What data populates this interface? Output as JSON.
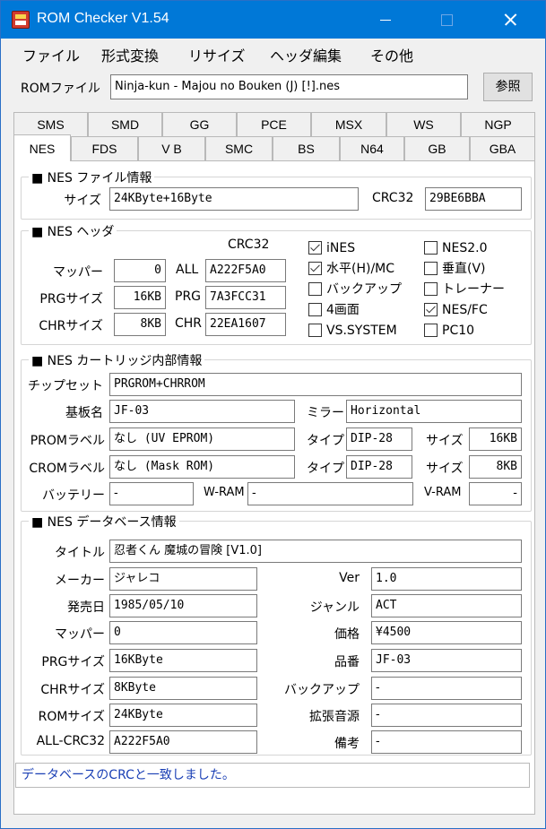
{
  "window": {
    "title": "ROM Checker V1.54"
  },
  "menu": [
    "ファイル",
    "形式変換",
    "リサイズ",
    "ヘッダ編集",
    "その他"
  ],
  "rom_file": {
    "label": "ROMファイル",
    "value": "Ninja-kun - Majou no Bouken (J) [!].nes",
    "browse_label": "参照"
  },
  "tabs_row1": [
    "SMS",
    "SMD",
    "GG",
    "PCE",
    "MSX",
    "WS",
    "NGP"
  ],
  "tabs_row2": [
    "NES",
    "FDS",
    "V B",
    "SMC",
    "BS",
    "N64",
    "GB",
    "GBA"
  ],
  "active_tab": "NES",
  "file_info": {
    "title": "■ NES ファイル情報",
    "size_label": "サイズ",
    "size_value": "24KByte+16Byte",
    "crc_label": "CRC32",
    "crc_value": "29BE6BBA"
  },
  "header": {
    "title": "■ NES ヘッダ",
    "crc_col_label": "CRC32",
    "mapper_label": "マッパー",
    "mapper_value": "0",
    "all_label": "ALL",
    "all_crc": "A222F5A0",
    "prg_size_label": "PRGサイズ",
    "prg_size_value": "16KB",
    "prg_label": "PRG",
    "prg_crc": "7A3FCC31",
    "chr_size_label": "CHRサイズ",
    "chr_size_value": "8KB",
    "chr_label": "CHR",
    "chr_crc": "22EA1607",
    "checks": [
      {
        "label": "iNES",
        "checked": true
      },
      {
        "label": "NES2.0",
        "checked": false
      },
      {
        "label": "水平(H)/MC",
        "checked": true
      },
      {
        "label": "垂直(V)",
        "checked": false
      },
      {
        "label": "バックアップ",
        "checked": false
      },
      {
        "label": "トレーナー",
        "checked": false
      },
      {
        "label": "4画面",
        "checked": false
      },
      {
        "label": "NES/FC",
        "checked": true
      },
      {
        "label": "VS.SYSTEM",
        "checked": false
      },
      {
        "label": "PC10",
        "checked": false
      }
    ]
  },
  "cart": {
    "title": "■ NES カートリッジ内部情報",
    "chipset_label": "チップセット",
    "chipset_value": "PRGROM+CHRROM",
    "board_label": "基板名",
    "board_value": "JF-03",
    "mirror_label": "ミラー",
    "mirror_value": "Horizontal",
    "prom_label": "PROMラベル",
    "prom_value": "なし (UV EPROM)",
    "prom_type_label": "タイプ",
    "prom_type_value": "DIP-28",
    "prom_size_label": "サイズ",
    "prom_size_value": "16KB",
    "crom_label": "CROMラベル",
    "crom_value": "なし (Mask ROM)",
    "crom_type_label": "タイプ",
    "crom_type_value": "DIP-28",
    "crom_size_label": "サイズ",
    "crom_size_value": "8KB",
    "battery_label": "バッテリー",
    "battery_value": "-",
    "wram_label": "W-RAM",
    "wram_value": "-",
    "vram_label": "V-RAM",
    "vram_value": "-"
  },
  "db": {
    "title": "■ NES データベース情報",
    "title_label": "タイトル",
    "title_value": "忍者くん 魔城の冒険 [V1.0]",
    "maker_label": "メーカー",
    "maker_value": "ジャレコ",
    "ver_label": "Ver",
    "ver_value": "1.0",
    "date_label": "発売日",
    "date_value": "1985/05/10",
    "genre_label": "ジャンル",
    "genre_value": "ACT",
    "mapper_label": "マッパー",
    "mapper_value": "0",
    "price_label": "価格",
    "price_value": "¥4500",
    "prg_label": "PRGサイズ",
    "prg_value": "16KByte",
    "code_label": "品番",
    "code_value": "JF-03",
    "chr_label": "CHRサイズ",
    "chr_value": "8KByte",
    "backup_label": "バックアップ",
    "backup_value": "-",
    "rom_label": "ROMサイズ",
    "rom_value": "24KByte",
    "sound_label": "拡張音源",
    "sound_value": "-",
    "allcrc_label": "ALL-CRC32",
    "allcrc_value": "A222F5A0",
    "note_label": "備考",
    "note_value": "-"
  },
  "status": "データベースのCRCと一致しました。"
}
